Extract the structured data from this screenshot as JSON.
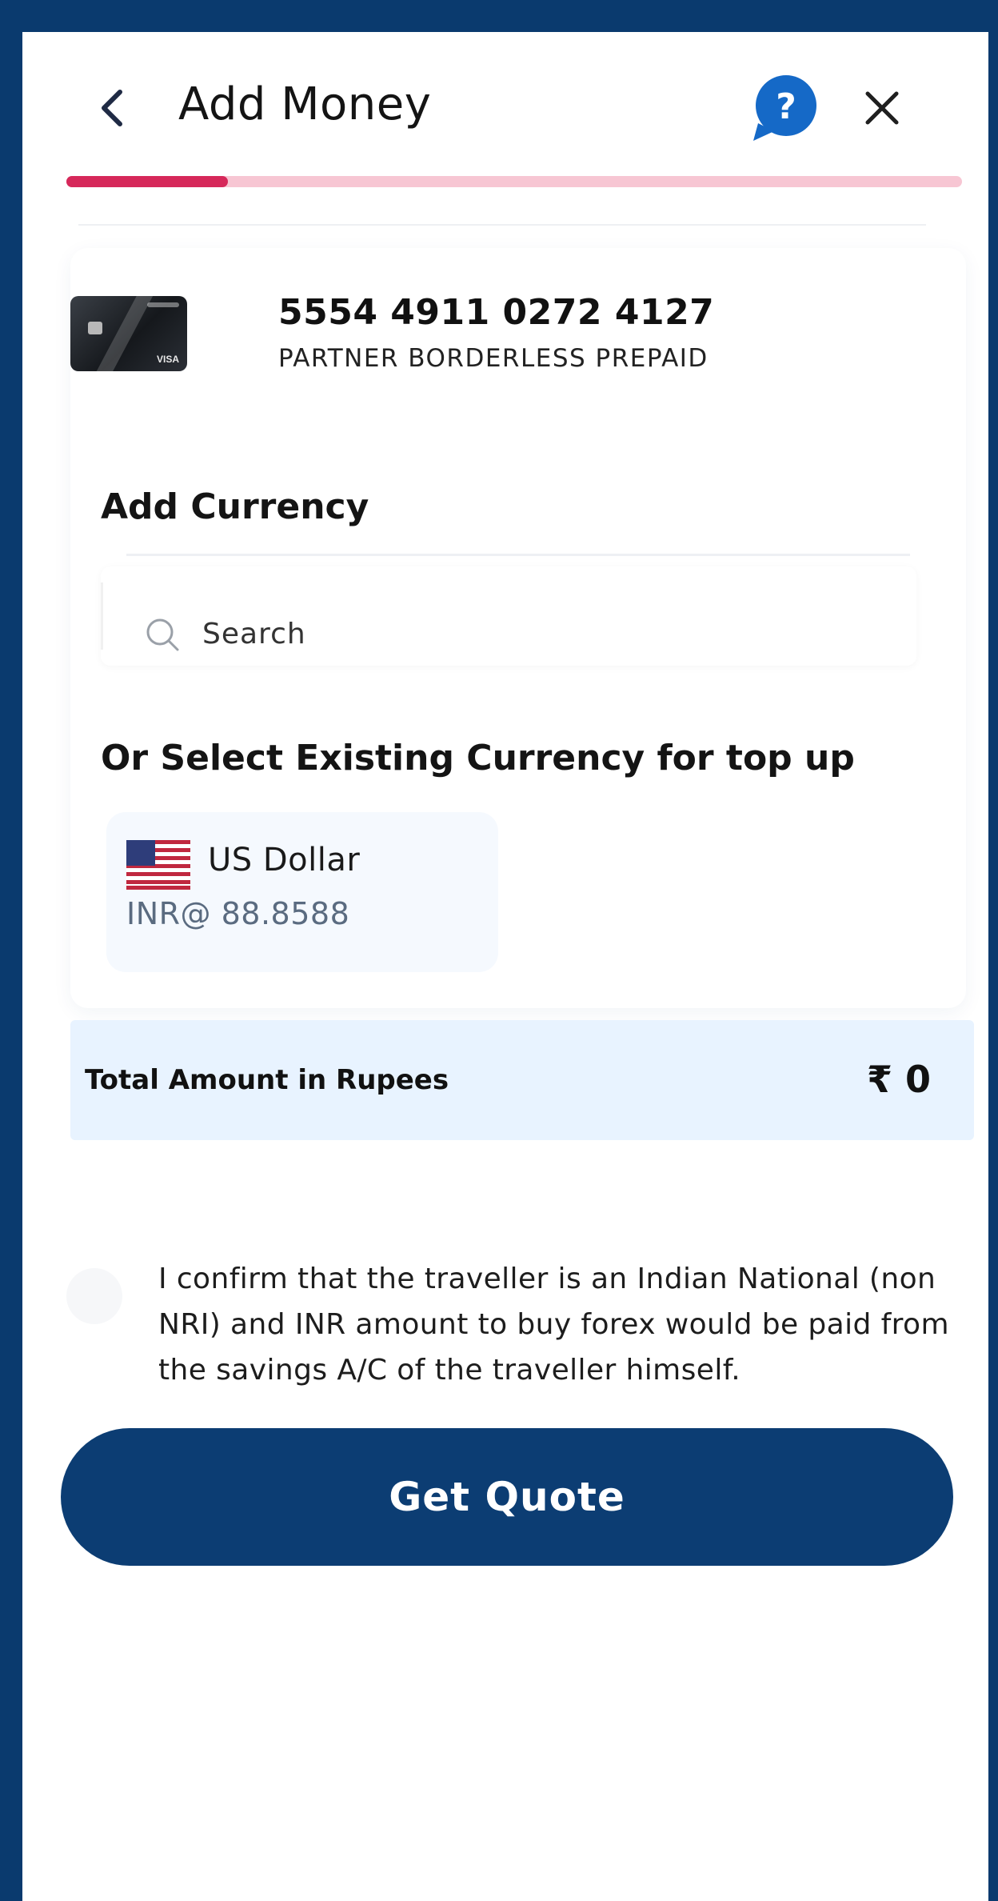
{
  "header": {
    "title": "Add Money",
    "help_icon": "help-bubble-icon",
    "close_icon": "close-icon",
    "back_icon": "chevron-left-icon",
    "progress": 0.18
  },
  "card": {
    "number": "5554 4911 0272 4127",
    "name": "PARTNER BORDERLESS PREPAID",
    "brand": "VISA"
  },
  "add_currency": {
    "label": "Add Currency",
    "search_placeholder": "Search"
  },
  "existing": {
    "label": "Or Select Existing Currency for top up",
    "currencies": [
      {
        "name": "US Dollar",
        "rate": "INR@ 88.8588",
        "flag": "us-flag-icon"
      }
    ]
  },
  "total": {
    "label": "Total Amount in Rupees",
    "value": "₹ 0"
  },
  "confirm": {
    "text": "I confirm that the traveller is an Indian National (non NRI) and INR amount to buy forex would be paid from the savings A/C of the traveller himself.",
    "checked": false
  },
  "actions": {
    "get_quote": "Get Quote"
  },
  "colors": {
    "brand": "#0c3d73",
    "accent": "#d6285a",
    "total_bg": "#e8f3ff",
    "help": "#1569c7"
  }
}
